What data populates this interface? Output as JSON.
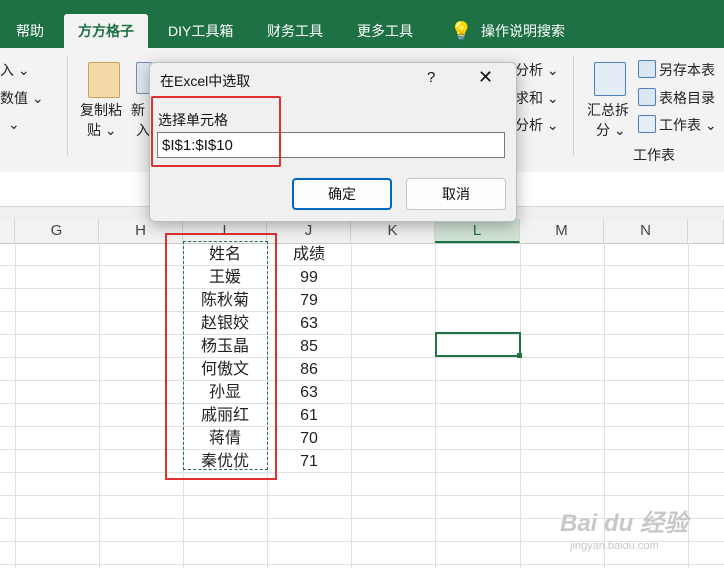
{
  "ribbon": {
    "tabs": [
      "帮助",
      "方方格子",
      "DIY工具箱",
      "财务工具",
      "更多工具",
      "操作说明搜索"
    ],
    "active_tab": "方方格子",
    "left_items": [
      "入 ⌄",
      "数值 ⌄",
      "⌄"
    ],
    "copy_paste": [
      "复制粘",
      "贴 ⌄"
    ],
    "new_insert": [
      "新",
      "入"
    ],
    "analysis": [
      "分析 ⌄",
      "求和 ⌄",
      "分析 ⌄"
    ],
    "split_summary": [
      "汇总拆",
      "分 ⌄"
    ],
    "right_items": [
      "另存本表",
      "表格目录",
      "工作表 ⌄"
    ],
    "group_label": "工作表"
  },
  "dialog": {
    "title": "在Excel中选取",
    "help": "?",
    "close": "✕",
    "field_label": "选择单元格",
    "field_value": "$I$1:$I$10",
    "ok_label": "确定",
    "cancel_label": "取消"
  },
  "columns": [
    "G",
    "H",
    "I",
    "J",
    "K",
    "L",
    "M",
    "N"
  ],
  "selected_column": "L",
  "table": {
    "header": [
      "姓名",
      "成绩"
    ],
    "rows": [
      [
        "王媛",
        "99"
      ],
      [
        "陈秋菊",
        "79"
      ],
      [
        "赵银姣",
        "63"
      ],
      [
        "杨玉晶",
        "85"
      ],
      [
        "何傲文",
        "86"
      ],
      [
        "孙显",
        "63"
      ],
      [
        "戚丽红",
        "61"
      ],
      [
        "蒋倩",
        "70"
      ],
      [
        "秦优优",
        "71"
      ]
    ]
  },
  "watermark": {
    "main": "Bai du 经验",
    "sub": "jingyan.baidu.com"
  },
  "colors": {
    "accent": "#1e7145",
    "highlight_frame": "#e03131",
    "ok_border": "#0067c0"
  }
}
